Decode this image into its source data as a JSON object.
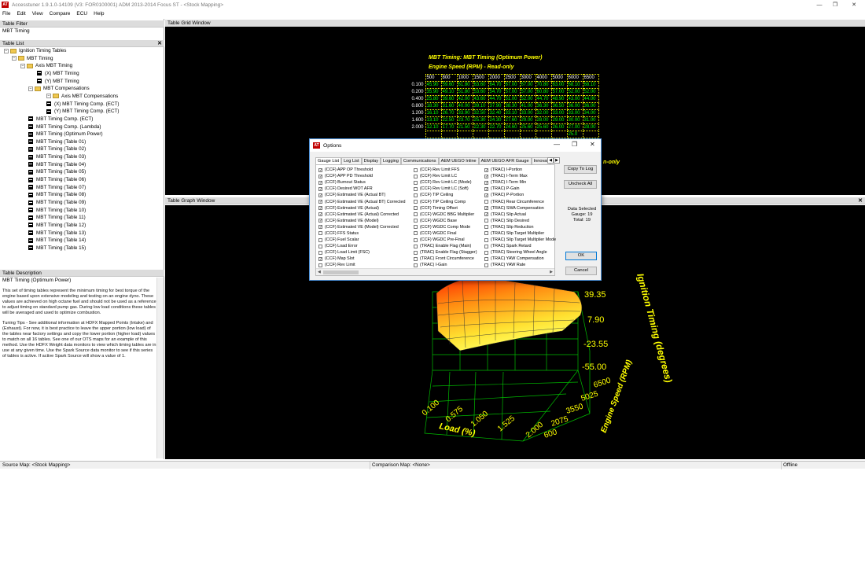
{
  "app": {
    "title": "Accesstuner 1.9.1.0-14109 (V3: FOR0100001) ADM 2013-2014 Focus ST - <Stock Mapping>",
    "icon_label": "AT",
    "window_controls": [
      "—",
      "❐",
      "✕"
    ]
  },
  "menu": [
    "File",
    "Edit",
    "View",
    "Compare",
    "ECU",
    "Help"
  ],
  "table_filter": {
    "header": "Table Filter",
    "value": "MBT Timing"
  },
  "table_list": {
    "header": "Table List",
    "close": "✕",
    "items": [
      {
        "label": "Ignition Timing Tables",
        "kind": "folder",
        "expander": "−"
      },
      {
        "label": "MBT Timing",
        "kind": "folder",
        "expander": "−"
      },
      {
        "label": "Axis MBT Timing",
        "kind": "folder",
        "expander": "−"
      },
      {
        "label": "(X) MBT Timing",
        "kind": "table"
      },
      {
        "label": "(Y) MBT Timing",
        "kind": "table"
      },
      {
        "label": "MBT Compensations",
        "kind": "folder",
        "expander": "−"
      },
      {
        "label": "Axis MBT Compensations",
        "kind": "folder",
        "expander": "−"
      },
      {
        "label": "(X) MBT Timing Comp. (ECT)",
        "kind": "table"
      },
      {
        "label": "(Y) MBT Timing Comp. (ECT)",
        "kind": "table"
      },
      {
        "label": "MBT Timing Comp. (ECT)",
        "kind": "table"
      },
      {
        "label": "MBT Timing Comp. (Lambda)",
        "kind": "table"
      },
      {
        "label": "MBT Timing (Optimum Power)",
        "kind": "table"
      },
      {
        "label": "MBT Timing (Table 01)",
        "kind": "table"
      },
      {
        "label": "MBT Timing (Table 02)",
        "kind": "table"
      },
      {
        "label": "MBT Timing (Table 03)",
        "kind": "table"
      },
      {
        "label": "MBT Timing (Table 04)",
        "kind": "table"
      },
      {
        "label": "MBT Timing (Table 05)",
        "kind": "table"
      },
      {
        "label": "MBT Timing (Table 06)",
        "kind": "table"
      },
      {
        "label": "MBT Timing (Table 07)",
        "kind": "table"
      },
      {
        "label": "MBT Timing (Table 08)",
        "kind": "table"
      },
      {
        "label": "MBT Timing (Table 09)",
        "kind": "table"
      },
      {
        "label": "MBT Timing (Table 10)",
        "kind": "table"
      },
      {
        "label": "MBT Timing (Table 11)",
        "kind": "table"
      },
      {
        "label": "MBT Timing (Table 12)",
        "kind": "table"
      },
      {
        "label": "MBT Timing (Table 13)",
        "kind": "table"
      },
      {
        "label": "MBT Timing (Table 14)",
        "kind": "table"
      },
      {
        "label": "MBT Timing (Table 15)",
        "kind": "table"
      }
    ]
  },
  "table_description": {
    "header": "Table Description",
    "title": "MBT Timing (Optimum Power)",
    "paragraph1": "This set of timing tables represent the minimum timing for best torque of the engine based upon extensive modeling and testing on an engine dyno. These values are achieved on high octane fuel and should not be used as a reference to adjust timing on standard pump gas. During low load conditions these tables will be averaged and used to optimize combustion.",
    "paragraph2": "Tuning Tips - See additional information at HDFX Mapped Points (Intake) and (Exhaust). For now, it is best practice to leave the upper portion (low load) of the tables near factory settings and copy the lower portion (higher load) values to match on all 16 tables. See one of our OTS maps for an example of this method. Use the HDFX Weight data monitors to view which timing tables are in use at any given time. Use the Spark Source data monitor to see if this series of tables is active. If active Spark Source will show a value of 1."
  },
  "grid_window": {
    "header": "Table Grid Window",
    "title": "MBT Timing: MBT Timing (Optimum Power)",
    "subtitle": "Engine Speed (RPM) - Read-only",
    "trailing_text": "n-only",
    "rpm_axis": [
      "500",
      "800",
      "1000",
      "1500",
      "2000",
      "2500",
      "3000",
      "4000",
      "5000",
      "6000",
      "6500"
    ],
    "rows": [
      {
        "load": "0.100",
        "values": [
          "45.90",
          "59.60",
          "61.80",
          "63.60",
          "64.70",
          "67.00",
          "67.00",
          "70.80",
          "63.00",
          "68.10",
          "68.10"
        ]
      },
      {
        "load": "0.200",
        "values": [
          "35.90",
          "49.10",
          "51.80",
          "53.60",
          "54.70",
          "57.00",
          "57.00",
          "60.80",
          "57.00",
          "52.00",
          "52.00"
        ]
      },
      {
        "load": "0.400",
        "values": [
          "25.80",
          "39.60",
          "42.00",
          "43.60",
          "44.70",
          "51.00",
          "52.00",
          "44.70",
          "48.90",
          "43.00",
          "44.00"
        ]
      },
      {
        "load": "0.800",
        "values": [
          "18.30",
          "31.60",
          "40.00",
          "39.10",
          "37.90",
          "38.30",
          "41.00",
          "36.30",
          "36.50",
          "36.00",
          "36.00"
        ]
      },
      {
        "load": "1.200",
        "values": [
          "16.10",
          "26.70",
          "33.90",
          "32.50",
          "32.40",
          "33.10",
          "33.00",
          "32.00",
          "33.00",
          "33.00",
          "34.00"
        ]
      },
      {
        "load": "1.600",
        "values": [
          "13.10",
          "22.50",
          "23.70",
          "25.30",
          "24.30",
          "27.60",
          "29.00",
          "28.00",
          "29.00",
          "30.00",
          "31.00"
        ]
      },
      {
        "load": "2.000",
        "values": [
          "12.10",
          "17.70",
          "21.50",
          "22.30",
          "22.70",
          "24.60",
          "25.60",
          "25.60",
          "26.00",
          "27.00",
          "28.00"
        ]
      },
      {
        "load": "",
        "values": [
          "",
          "",
          "",
          "",
          "",
          "",
          "",
          "",
          "",
          "25.0",
          ""
        ]
      },
      {
        "load": "",
        "values": [
          "",
          "",
          "",
          "",
          "",
          "",
          "",
          "",
          "",
          "",
          ""
        ]
      }
    ]
  },
  "graph_window": {
    "header": "Table Graph Window",
    "z_title": "Ignition Timing (degrees)",
    "z_ticks": [
      "39.35",
      "7.90",
      "-23.55",
      "-55.00"
    ],
    "x_title": "Load (%)",
    "x_ticks": [
      "0.100",
      "0.575",
      "1.050",
      "1.525",
      "2.000"
    ],
    "y_title": "Engine Speed (RPM)",
    "y_ticks": [
      "6500",
      "5025",
      "3550",
      "2075",
      "600"
    ]
  },
  "options_dialog": {
    "title": "Options",
    "tabs": [
      "Gauge List",
      "Log List",
      "Display",
      "Logging",
      "Communications",
      "AEM UEGO Inline",
      "AEM UEGO AFR Gauge",
      "Innovat"
    ],
    "active_tab": "Gauge List",
    "col1": [
      {
        "label": "(CCF) APP OP Threshold",
        "checked": true
      },
      {
        "label": "(CCF) APP PD Threshold",
        "checked": true
      },
      {
        "label": "(CCF) Burnout Status",
        "checked": true
      },
      {
        "label": "(CCF) Desired WOT AFR",
        "checked": true
      },
      {
        "label": "(CCF) Estimated VE (Actual BT)",
        "checked": true
      },
      {
        "label": "(CCF) Estimated VE (Actual BT) Corrected",
        "checked": true
      },
      {
        "label": "(CCF) Estimated VE (Actual)",
        "checked": true
      },
      {
        "label": "(CCF) Estimated VE (Actual) Corrected",
        "checked": true
      },
      {
        "label": "(CCF) Estimated VE (Model)",
        "checked": true
      },
      {
        "label": "(CCF) Estimated VE (Model) Corrected",
        "checked": true
      },
      {
        "label": "(CCF) FFS Status",
        "checked": false
      },
      {
        "label": "(CCF) Fuel Scalar",
        "checked": false
      },
      {
        "label": "(CCF) Load Error",
        "checked": false
      },
      {
        "label": "(CCF) Load Limit (FSC)",
        "checked": false
      },
      {
        "label": "(CCF) Map Slot",
        "checked": true
      },
      {
        "label": "(CCF) Rev Limit",
        "checked": false
      }
    ],
    "col2": [
      {
        "label": "(CCF) Rev Limit FFS",
        "checked": false
      },
      {
        "label": "(CCF) Rev Limit LC",
        "checked": false
      },
      {
        "label": "(CCF) Rev Limit LC (Mode)",
        "checked": false
      },
      {
        "label": "(CCF) Rev Limit LC (Soft)",
        "checked": false
      },
      {
        "label": "(CCF) TIP Ceiling",
        "checked": false
      },
      {
        "label": "(CCF) TIP Ceiling Comp",
        "checked": false
      },
      {
        "label": "(CCF) Timing Offset",
        "checked": false
      },
      {
        "label": "(CCF) WGDC BBG Multiplier",
        "checked": false
      },
      {
        "label": "(CCF) WGDC Base",
        "checked": false
      },
      {
        "label": "(CCF) WGDC Comp Mode",
        "checked": false
      },
      {
        "label": "(CCF) WGDC Final",
        "checked": false
      },
      {
        "label": "(CCF) WGDC Pre-Final",
        "checked": false
      },
      {
        "label": "(TRAC) Enable Flag (Main)",
        "checked": false
      },
      {
        "label": "(TRAC) Enable Flag (Stagger)",
        "checked": false
      },
      {
        "label": "(TRAC) Front Circumference",
        "checked": false
      },
      {
        "label": "(TRAC) I-Gain",
        "checked": false
      }
    ],
    "col3": [
      {
        "label": "(TRAC) I-Portion",
        "checked": true
      },
      {
        "label": "(TRAC) I-Term Max",
        "checked": true
      },
      {
        "label": "(TRAC) I-Term Min",
        "checked": true
      },
      {
        "label": "(TRAC) P-Gain",
        "checked": true
      },
      {
        "label": "(TRAC) P-Portion",
        "checked": true
      },
      {
        "label": "(TRAC) Rear Circumference",
        "checked": false
      },
      {
        "label": "(TRAC) SWA Compensation",
        "checked": true
      },
      {
        "label": "(TRAC) Slip Actual",
        "checked": true
      },
      {
        "label": "(TRAC) Slip Desired",
        "checked": false
      },
      {
        "label": "(TRAC) Slip Reduction",
        "checked": false
      },
      {
        "label": "(TRAC) Slip Target Multiplier",
        "checked": false
      },
      {
        "label": "(TRAC) Slip Target Multiplier Mode",
        "checked": false
      },
      {
        "label": "(TRAC) Spark Retard",
        "checked": false
      },
      {
        "label": "(TRAC) Steering Wheel Angle",
        "checked": false
      },
      {
        "label": "(TRAC) YAW Compensation",
        "checked": false
      },
      {
        "label": "(TRAC) YAW Rate",
        "checked": false
      }
    ],
    "buttons": {
      "copy_to_log": "Copy To Log",
      "uncheck_all": "Uncheck All",
      "ok": "OK",
      "cancel": "Cancel"
    },
    "info": {
      "line1": "Data Selected",
      "line2": "Gauge: 19",
      "line3": "Total: 19"
    }
  },
  "status": {
    "source": "Source Map: <Stock Mapping>",
    "comparison": "Comparison Map: <None>",
    "connection": "Offline"
  },
  "colors": {
    "accent_yellow": "#ffff00",
    "cell_green": "#00ff00",
    "surface_hot": "#ff3300",
    "surface_cold": "#ffff40",
    "wire_green": "#00cc00"
  }
}
